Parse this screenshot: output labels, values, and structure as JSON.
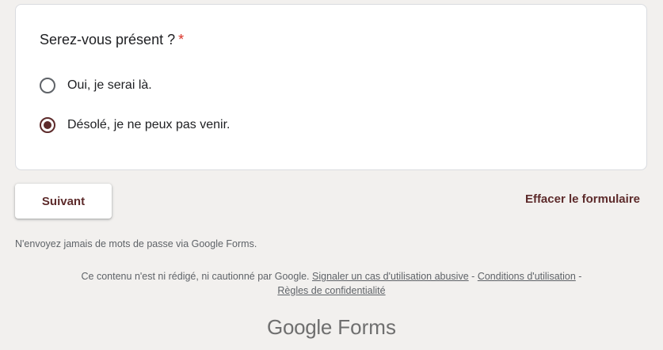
{
  "question": {
    "title": "Serez-vous présent ?",
    "required_marker": "*",
    "options": [
      {
        "label": "Oui, je serai là.",
        "selected": false
      },
      {
        "label": "Désolé, je ne peux pas venir.",
        "selected": true
      }
    ]
  },
  "actions": {
    "next_label": "Suivant",
    "clear_label": "Effacer le formulaire"
  },
  "footer": {
    "password_warning": "N'envoyez jamais de mots de passe via Google Forms.",
    "disclaimer_text": "Ce contenu n'est ni rédigé, ni cautionné par Google.",
    "report_link": "Signaler un cas d'utilisation abusive",
    "separator": "-",
    "terms_link": "Conditions d'utilisation",
    "privacy_link": "Règles de confidentialité",
    "brand_google": "Google",
    "brand_forms": "Forms"
  },
  "colors": {
    "background": "#f2f0ee",
    "accent": "#5d2b2b",
    "required": "#d93025"
  }
}
